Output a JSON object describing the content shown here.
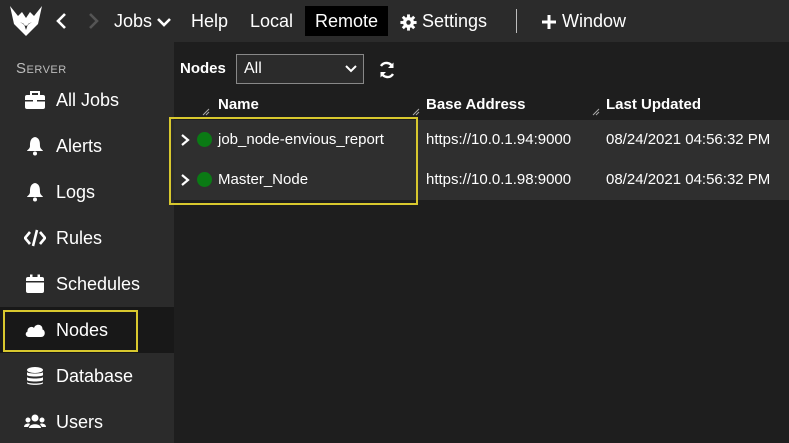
{
  "topbar": {
    "menu": {
      "jobs": "Jobs",
      "help": "Help",
      "local": "Local",
      "remote": "Remote",
      "settings": "Settings",
      "window": "Window"
    }
  },
  "sidebar": {
    "heading": "Server",
    "items": [
      {
        "label": "All Jobs",
        "icon": "briefcase-icon"
      },
      {
        "label": "Alerts",
        "icon": "bell-icon"
      },
      {
        "label": "Logs",
        "icon": "bell-icon"
      },
      {
        "label": "Rules",
        "icon": "code-icon"
      },
      {
        "label": "Schedules",
        "icon": "calendar-icon"
      },
      {
        "label": "Nodes",
        "icon": "cloud-icon"
      },
      {
        "label": "Database",
        "icon": "database-icon"
      },
      {
        "label": "Users",
        "icon": "users-icon"
      }
    ],
    "active": "Nodes"
  },
  "main": {
    "filter": {
      "label": "Nodes",
      "value": "All"
    },
    "table": {
      "columns": [
        "Name",
        "Base Address",
        "Last Updated"
      ],
      "rows": [
        {
          "name": "job_node-envious_report",
          "address": "https://10.0.1.94:9000",
          "updated": "08/24/2021 04:56:32 PM",
          "status_color": "#0a7a14"
        },
        {
          "name": "Master_Node",
          "address": "https://10.0.1.98:9000",
          "updated": "08/24/2021 04:56:32 PM",
          "status_color": "#0a7a14"
        }
      ]
    }
  },
  "colors": {
    "accent_highlight": "#d8c82e",
    "status_online": "#0a7a14",
    "bar_bg": "#2b2b2b",
    "main_bg": "#1e1e1e"
  }
}
